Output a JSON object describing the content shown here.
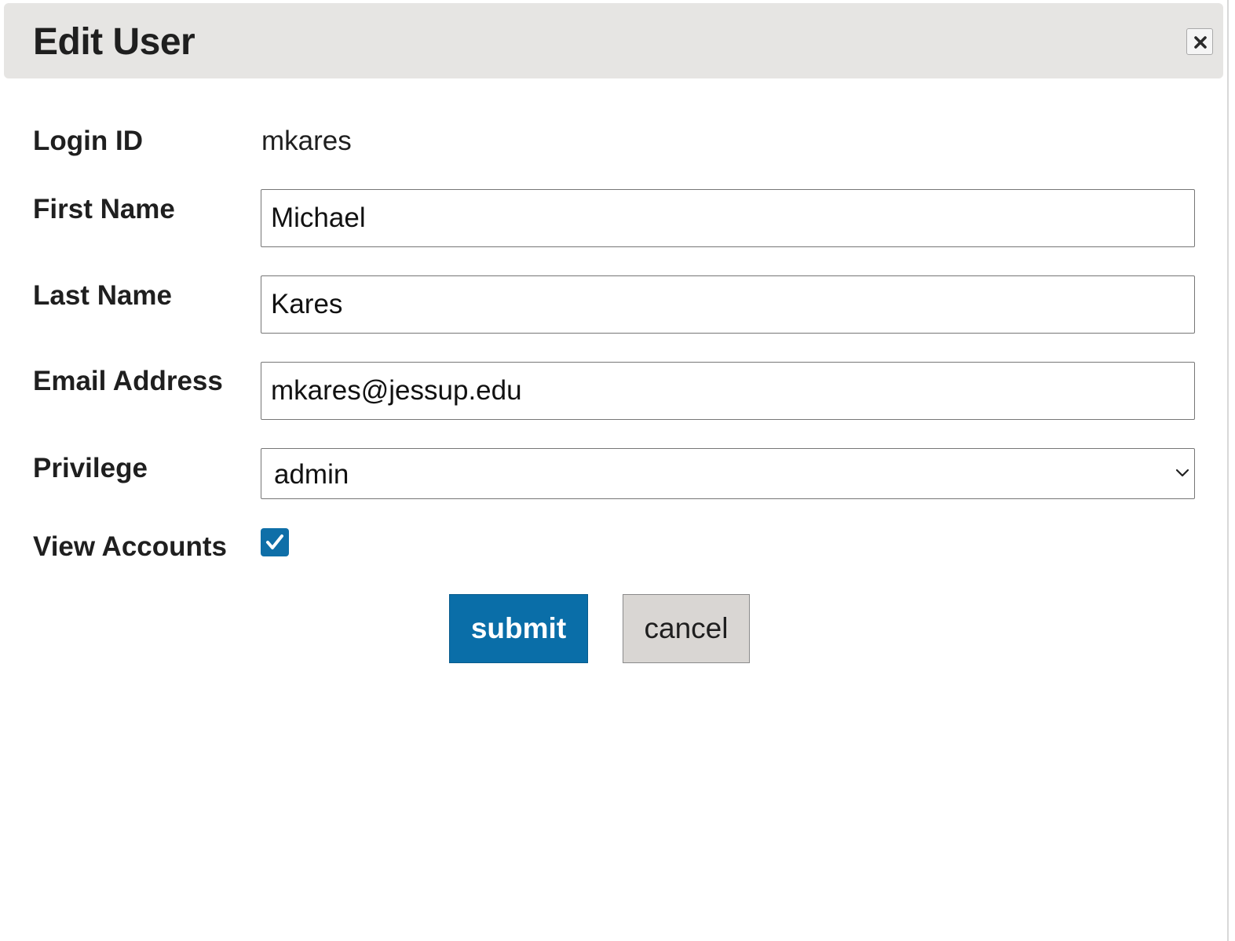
{
  "dialog": {
    "title": "Edit User",
    "close_icon": "close-icon"
  },
  "form": {
    "login_id": {
      "label": "Login ID",
      "value": "mkares"
    },
    "first_name": {
      "label": "First Name",
      "value": "Michael"
    },
    "last_name": {
      "label": "Last Name",
      "value": "Kares"
    },
    "email": {
      "label": "Email Address",
      "value": "mkares@jessup.edu"
    },
    "privilege": {
      "label": "Privilege",
      "selected": "admin",
      "icon": "chevron-down-icon"
    },
    "view_accounts": {
      "label": "View Accounts",
      "checked": true,
      "icon": "checkmark-icon"
    }
  },
  "actions": {
    "submit_label": "submit",
    "cancel_label": "cancel"
  },
  "colors": {
    "titlebar_bg": "#e6e5e3",
    "accent": "#0a6ea8",
    "cancel_bg": "#d9d6d3"
  }
}
